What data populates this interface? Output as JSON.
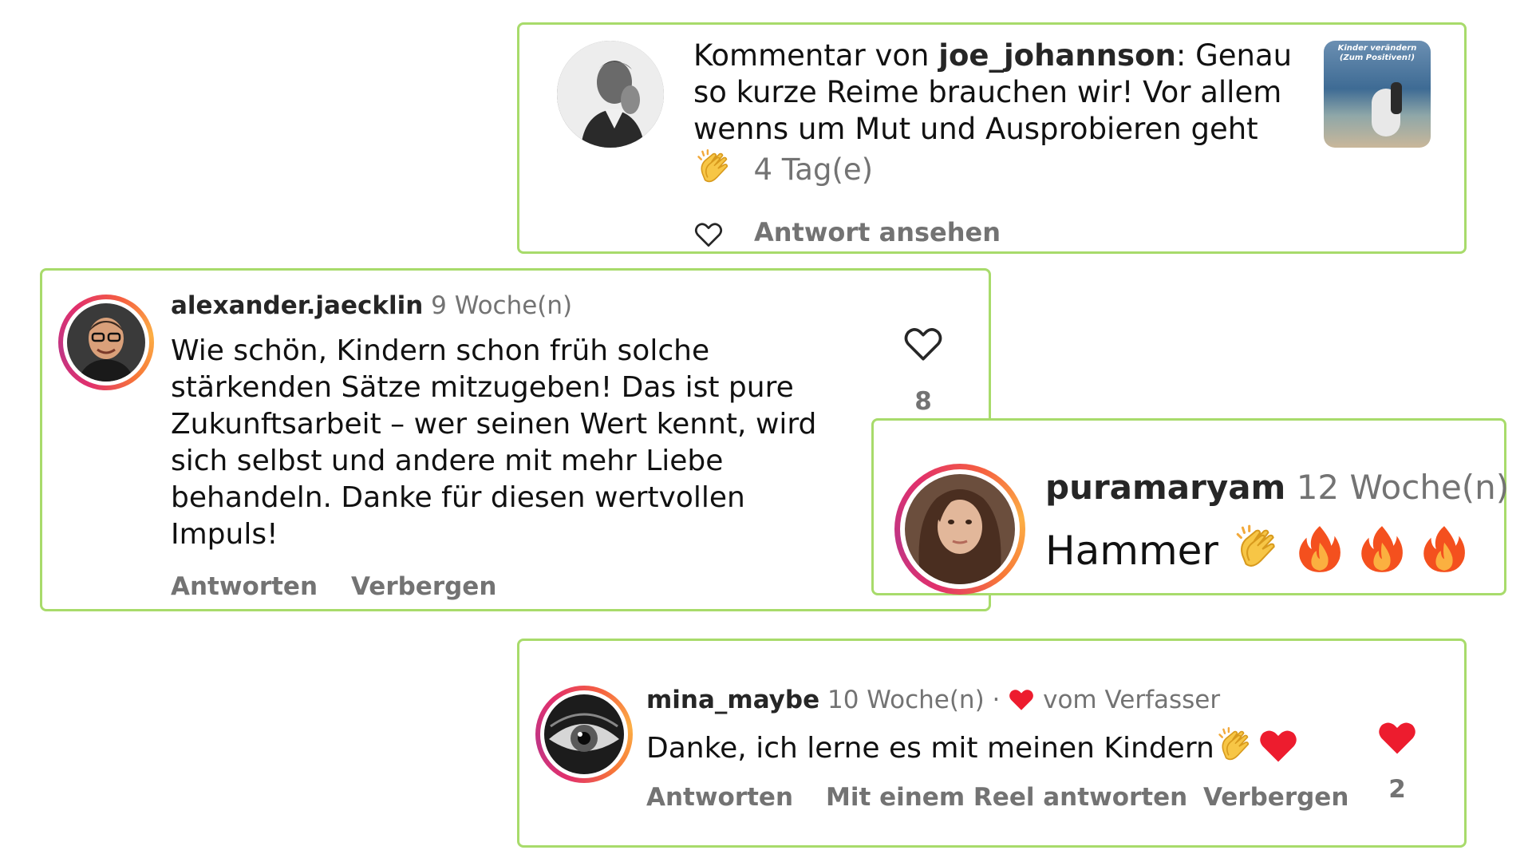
{
  "colors": {
    "card_border": "#a8db6b",
    "username": "#262626",
    "meta": "#737373",
    "like_red": "#ed1c2e"
  },
  "card_joe": {
    "prefix": "Kommentar von",
    "username": "joe_johannson",
    "text_line1_tail": ": Genau",
    "text_line2": "so kurze Reime brauchen wir! Vor allem",
    "text_line3": "wenns um Mut und Ausprobieren geht",
    "emoji": "clapping-hands-icon",
    "time": "4 Tag(e)",
    "view_replies": "Antwort ansehen",
    "thumbnail_title_line1": "Kinder verändern",
    "thumbnail_title_line2": "(Zum Positiven!)"
  },
  "card_alexander": {
    "username": "alexander.jaecklin",
    "time": "9 Woche(n)",
    "lines": [
      "Wie schön, Kindern schon früh solche",
      "stärkenden Sätze mitzugeben! Das ist pure",
      "Zukunftsarbeit – wer seinen Wert kennt, wird",
      "sich selbst und andere mit mehr Liebe",
      "behandeln. Danke für diesen wertvollen",
      "Impuls!"
    ],
    "reply": "Antworten",
    "hide": "Verbergen",
    "like_count": "8"
  },
  "card_pura": {
    "username": "puramaryam",
    "time": "12 Woche(n)",
    "text": "Hammer",
    "emojis": [
      "clapping-hands-icon",
      "fire-icon",
      "fire-icon",
      "fire-icon"
    ]
  },
  "card_mina": {
    "username": "mina_maybe",
    "time": "10 Woche(n)",
    "separator": "·",
    "author_badge": "vom Verfasser",
    "text": "Danke, ich lerne es mit meinen Kindern",
    "emojis": [
      "clapping-hands-icon",
      "red-heart-icon"
    ],
    "reply": "Antworten",
    "reel_reply": "Mit einem Reel antworten",
    "hide": "Verbergen",
    "like_count": "2"
  }
}
